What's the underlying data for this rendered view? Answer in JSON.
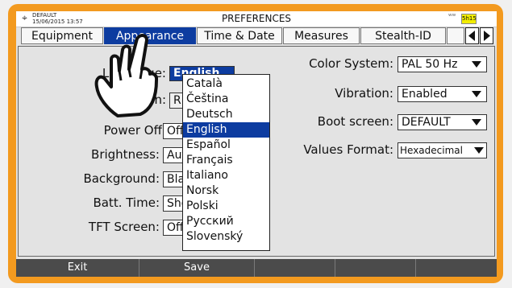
{
  "status": {
    "gps_icon": "gps-icon",
    "datetime_line1": "DEFAULT",
    "datetime_line2": "15/06/2015 13:57",
    "title": "PREFERENCES",
    "signal_icon": "signal-icon",
    "battery": "5h15"
  },
  "tabs": [
    {
      "label": "Equipment",
      "active": false
    },
    {
      "label": "Appearance",
      "active": true
    },
    {
      "label": "Time & Date",
      "active": false
    },
    {
      "label": "Measures",
      "active": false
    },
    {
      "label": "Stealth-ID",
      "active": false
    }
  ],
  "left": {
    "language_label": "Language:",
    "language_value": "English",
    "skin_label": "Skin:",
    "skin_value": "RED",
    "power_off_label": "Power Off:",
    "power_off_value": "Off",
    "brightness_label": "Brightness:",
    "brightness_value": "Auto",
    "background_label": "Background:",
    "background_value": "Black",
    "batt_time_label": "Batt. Time:",
    "batt_time_value": "Show",
    "tft_screen_label": "TFT Screen:",
    "tft_screen_value": "Off"
  },
  "right": {
    "color_system_label": "Color System:",
    "color_system_value": "PAL 50 Hz",
    "vibration_label": "Vibration:",
    "vibration_value": "Enabled",
    "boot_screen_label": "Boot screen:",
    "boot_screen_value": "DEFAULT",
    "values_format_label": "Values Format:",
    "values_format_value": "Hexadecimal"
  },
  "language_menu": {
    "options": [
      "Català",
      "Čeština",
      "Deutsch",
      "English",
      "Español",
      "Français",
      "Italiano",
      "Norsk",
      "Polski",
      "Русский",
      "Slovenský"
    ],
    "selected": "English"
  },
  "footer": {
    "buttons": [
      "Exit",
      "Save",
      "",
      "",
      ""
    ]
  }
}
